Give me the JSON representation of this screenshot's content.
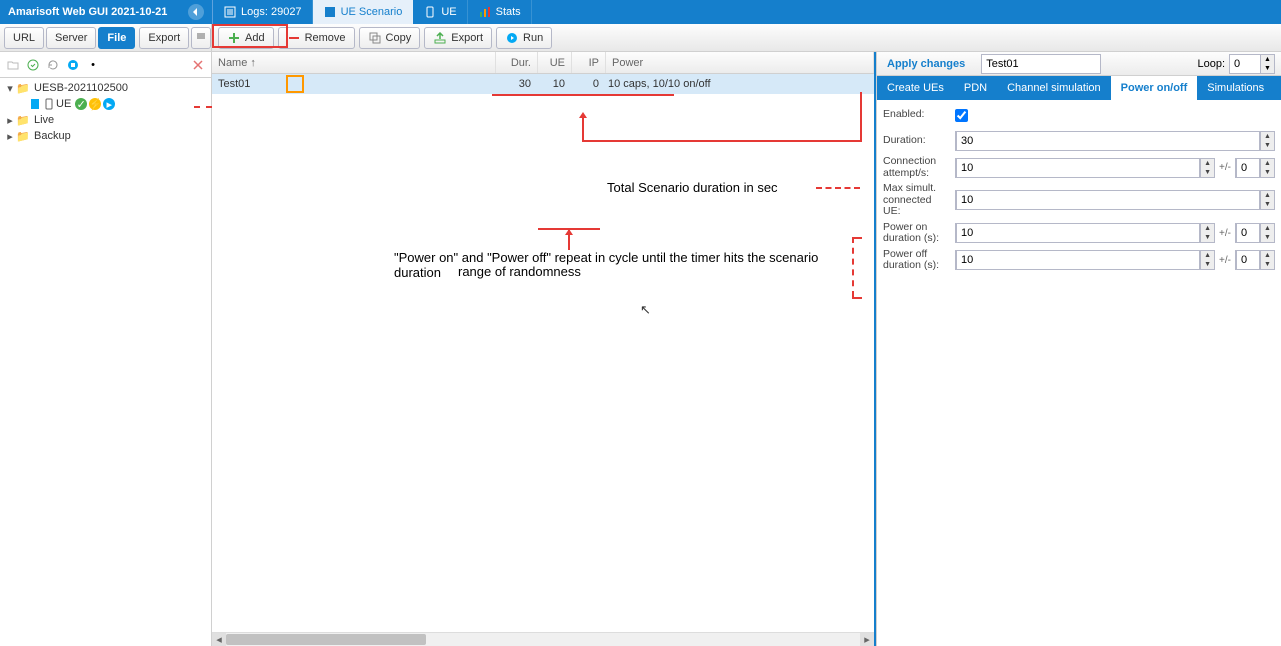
{
  "app": {
    "title": "Amarisoft Web GUI 2021-10-21"
  },
  "sidebar_toolbar": {
    "url": "URL",
    "server": "Server",
    "file": "File",
    "export": "Export"
  },
  "tree": {
    "root": "UESB-2021102500",
    "ue": "UE",
    "live": "Live",
    "backup": "Backup"
  },
  "main_tabs": {
    "logs": "Logs: 29027",
    "ue_scenario": "UE Scenario",
    "ue": "UE",
    "stats": "Stats"
  },
  "main_toolbar": {
    "add": "Add",
    "remove": "Remove",
    "copy": "Copy",
    "export": "Export",
    "run": "Run"
  },
  "grid": {
    "headers": {
      "name": "Name ↑",
      "dur": "Dur.",
      "ue": "UE",
      "ip": "IP",
      "power": "Power"
    },
    "row": {
      "name": "Test01",
      "dur": "30",
      "ue": "10",
      "ip": "0",
      "power": "10 caps, 10/10 on/off"
    }
  },
  "annotations": {
    "total_dur": "Total Scenario duration in sec",
    "cycle": "\"Power on\" and \"Power off\" repeat in cycle until the timer hits the scenario duration",
    "randomness": "range of randomness"
  },
  "right_panel": {
    "apply": "Apply changes",
    "name": "Test01",
    "loop_label": "Loop:",
    "loop_value": "0",
    "tabs": {
      "create": "Create UEs",
      "pdn": "PDN",
      "channel": "Channel simulation",
      "power": "Power on/off",
      "sim": "Simulations"
    },
    "form": {
      "enabled_label": "Enabled:",
      "duration_label": "Duration:",
      "duration": "30",
      "capps_label": "Connection attempt/s:",
      "capps": "10",
      "capps_pm": "0",
      "maxue_label": "Max simult. connected UE:",
      "maxue": "10",
      "pon_label": "Power on duration (s):",
      "pon": "10",
      "pon_pm": "0",
      "poff_label": "Power off duration (s):",
      "poff": "10",
      "poff_pm": "0",
      "pm_label": "+/-"
    }
  }
}
